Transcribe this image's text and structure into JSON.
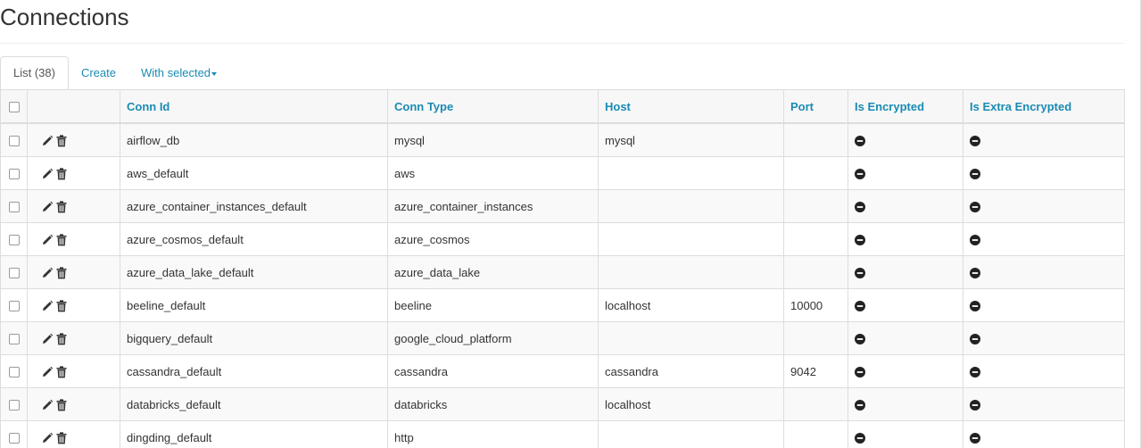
{
  "page": {
    "title": "Connections"
  },
  "tabs": {
    "list_label": "List (38)",
    "create_label": "Create",
    "with_selected_label": "With selected"
  },
  "table": {
    "columns": {
      "conn_id": "Conn Id",
      "conn_type": "Conn Type",
      "host": "Host",
      "port": "Port",
      "is_encrypted": "Is Encrypted",
      "is_extra_encrypted": "Is Extra Encrypted"
    },
    "rows": [
      {
        "conn_id": "airflow_db",
        "conn_type": "mysql",
        "host": "mysql",
        "port": "",
        "is_encrypted": "minus-circle-icon",
        "is_extra_encrypted": "minus-circle-icon"
      },
      {
        "conn_id": "aws_default",
        "conn_type": "aws",
        "host": "",
        "port": "",
        "is_encrypted": "minus-circle-icon",
        "is_extra_encrypted": "minus-circle-icon"
      },
      {
        "conn_id": "azure_container_instances_default",
        "conn_type": "azure_container_instances",
        "host": "",
        "port": "",
        "is_encrypted": "minus-circle-icon",
        "is_extra_encrypted": "minus-circle-icon"
      },
      {
        "conn_id": "azure_cosmos_default",
        "conn_type": "azure_cosmos",
        "host": "",
        "port": "",
        "is_encrypted": "minus-circle-icon",
        "is_extra_encrypted": "minus-circle-icon"
      },
      {
        "conn_id": "azure_data_lake_default",
        "conn_type": "azure_data_lake",
        "host": "",
        "port": "",
        "is_encrypted": "minus-circle-icon",
        "is_extra_encrypted": "minus-circle-icon"
      },
      {
        "conn_id": "beeline_default",
        "conn_type": "beeline",
        "host": "localhost",
        "port": "10000",
        "is_encrypted": "minus-circle-icon",
        "is_extra_encrypted": "minus-circle-icon"
      },
      {
        "conn_id": "bigquery_default",
        "conn_type": "google_cloud_platform",
        "host": "",
        "port": "",
        "is_encrypted": "minus-circle-icon",
        "is_extra_encrypted": "minus-circle-icon"
      },
      {
        "conn_id": "cassandra_default",
        "conn_type": "cassandra",
        "host": "cassandra",
        "port": "9042",
        "is_encrypted": "minus-circle-icon",
        "is_extra_encrypted": "minus-circle-icon"
      },
      {
        "conn_id": "databricks_default",
        "conn_type": "databricks",
        "host": "localhost",
        "port": "",
        "is_encrypted": "minus-circle-icon",
        "is_extra_encrypted": "minus-circle-icon"
      },
      {
        "conn_id": "dingding_default",
        "conn_type": "http",
        "host": "",
        "port": "",
        "is_encrypted": "minus-circle-icon",
        "is_extra_encrypted": "minus-circle-icon"
      }
    ]
  },
  "icons": {
    "edit": "pencil-icon",
    "delete": "trash-icon"
  },
  "colors": {
    "link": "#1a8bb3",
    "status_icon": "#222222"
  }
}
